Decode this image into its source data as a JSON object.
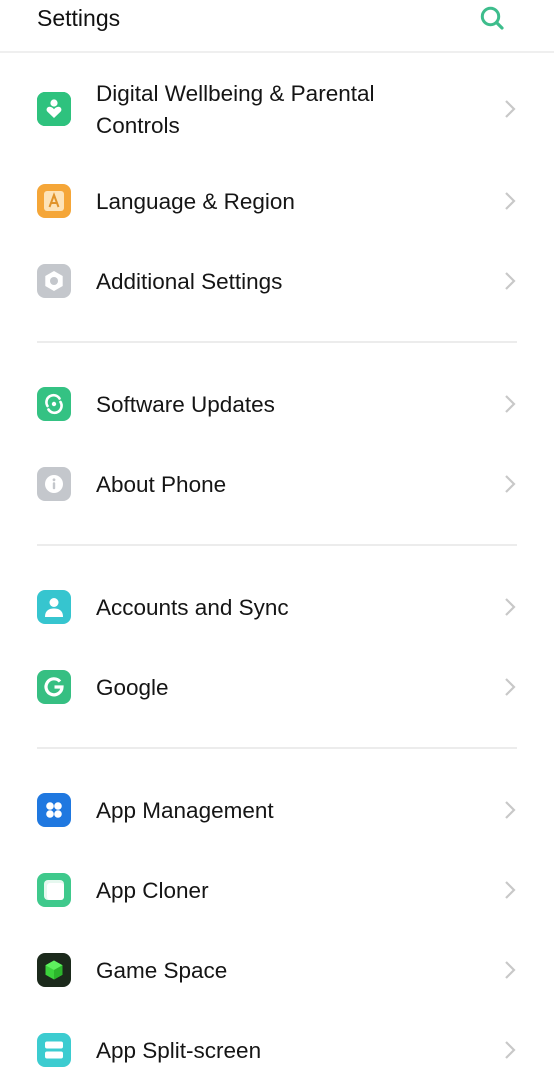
{
  "header": {
    "title": "Settings",
    "search_icon": "search-icon",
    "accent": "#3dbd8c"
  },
  "items": [
    {
      "label": "Digital Wellbeing & Parental Controls",
      "label_line1": "Digital Wellbeing & Parental",
      "label_line2": "Controls",
      "icon": "heart-person-icon",
      "color": "#2ec27e"
    },
    {
      "label": "Language & Region",
      "icon": "language-icon",
      "color": "#f5a638"
    },
    {
      "label": "Additional Settings",
      "icon": "hex-nut-icon",
      "color": "#c4c7cc"
    },
    {
      "label": "Software Updates",
      "icon": "update-icon",
      "color": "#34c283"
    },
    {
      "label": "About Phone",
      "icon": "info-icon",
      "color": "#c4c7cc"
    },
    {
      "label": "Accounts and Sync",
      "icon": "account-icon",
      "color": "#36c5cf"
    },
    {
      "label": "Google",
      "icon": "google-icon",
      "color": "#36bf82"
    },
    {
      "label": "App Management",
      "icon": "app-grid-icon",
      "color": "#1f78e0"
    },
    {
      "label": "App Cloner",
      "icon": "app-cloner-icon",
      "color": "#3fc98c"
    },
    {
      "label": "Game Space",
      "icon": "game-cube-icon",
      "color": "#1f2a1f"
    },
    {
      "label": "App Split-screen",
      "icon": "split-screen-icon",
      "color": "#3cccd0"
    }
  ],
  "chevron_color": "#c8c8c8",
  "divider_color": "#ececec"
}
